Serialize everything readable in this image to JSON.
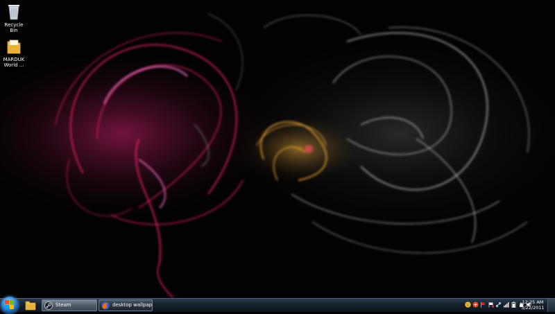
{
  "desktop": {
    "icons": [
      {
        "label": "Recycle Bin",
        "icon": "recycle-bin-icon"
      },
      {
        "label": "MARDUK World ...",
        "icon": "folder-icon"
      }
    ]
  },
  "taskbar": {
    "start_icon": "windows-logo-icon",
    "pinned": [
      {
        "icon": "windows-explorer-icon"
      }
    ],
    "tasks": [
      {
        "label": "Steam",
        "icon": "steam-icon",
        "active": true
      },
      {
        "label": "desktop wallpape...",
        "icon": "firefox-icon",
        "active": false
      }
    ],
    "tray_icons": [
      "smiley-icon",
      "antivirus-icon",
      "red-flag-icon",
      "action-center-flag-icon",
      "network-icon",
      "signal-bars-icon",
      "battery-icon",
      "hand-icon",
      "volume-icon"
    ],
    "clock": {
      "time": "12:25 AM",
      "date": "3/22/2011"
    }
  },
  "colors": {
    "wallpaper_red": "#ff2a6a",
    "wallpaper_gold": "#ffb43a",
    "wallpaper_white": "#e8f0ec",
    "taskbar": "#17212d"
  }
}
